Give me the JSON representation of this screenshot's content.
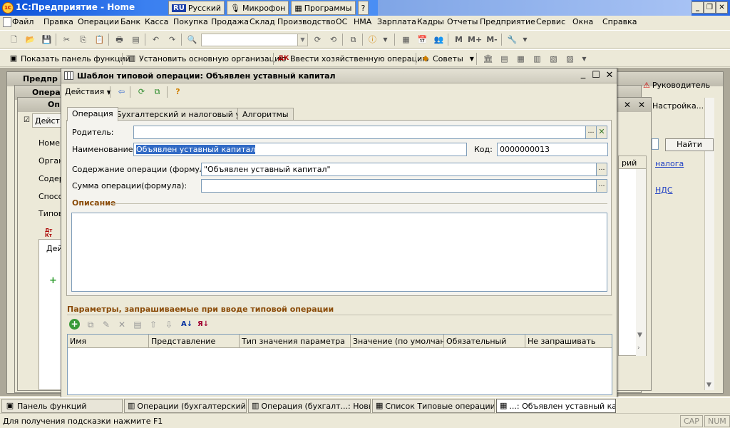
{
  "app": {
    "title": "1С:Предприятие - Home",
    "icon_label": "1C",
    "lang_bar": {
      "lang_code": "RU",
      "lang_name": "Русский",
      "mic": "Микрофон",
      "programs": "Программы",
      "help": "?"
    }
  },
  "menu": {
    "items": [
      "Файл",
      "Правка",
      "Операции",
      "Банк",
      "Касса",
      "Покупка",
      "Продажа",
      "Склад",
      "Производство",
      "ОС",
      "НМА",
      "Зарплата",
      "Кадры",
      "Отчеты",
      "Предприятие",
      "Сервис",
      "Окна",
      "Справка"
    ]
  },
  "toolbar2": {
    "show_panel": "Показать панель функций",
    "set_org": "Установить основную организацию",
    "enter_op": "Ввести хозяйственную операцию",
    "tips": "Советы"
  },
  "background": {
    "win1_title_part": "Предпр",
    "win2_title_part": "Опера",
    "win3_title_part": "Оп",
    "tab_fragment": "Де",
    "actions_fragment": "Дейст",
    "labels": [
      "Номер",
      "Орган",
      "Содер",
      "Спосо",
      "Типов"
    ],
    "dk_fragment": "Дт\nКт",
    "de_fragment": "Дей",
    "role_tr": "тр",
    "role_head": "Руководитель",
    "settings": "Настройка...",
    "find_button": "Найти",
    "col_fragment": "рий",
    "link_tax": "налога",
    "link_vat": "НДС"
  },
  "dialog": {
    "title": "Шаблон типовой операции: Объявлен уставный капитал",
    "actions": "Действия",
    "tabs": [
      "Операция",
      "Бухгалтерский и налоговый учет",
      "Алгоритмы"
    ],
    "active_tab": 0,
    "fields": {
      "parent_label": "Родитель:",
      "parent_value": "",
      "name_label": "Наименование:",
      "name_value": "Объявлен уставный капитал",
      "code_label": "Код:",
      "code_value": "0000000013",
      "content_label": "Содержание операции (формула):",
      "content_value": "\"Объявлен уставный капитал\"",
      "sum_label": "Сумма операции(формула):",
      "sum_value": ""
    },
    "description_title": "Описание",
    "description_value": "",
    "params_title": "Параметры, запрашиваемые при вводе типовой операции",
    "params_columns": [
      "Имя",
      "Представление",
      "Тип значения параметра",
      "Значение (по умолчан...",
      "Обязательный",
      "Не запрашивать"
    ]
  },
  "taskbar": {
    "items": [
      "Панель функций",
      "Операции (бухгалтерский и...",
      "Операция (бухгалт...: Новый *",
      "Список Типовые операции",
      "...: Объявлен уставный кап..."
    ],
    "active_index": 4
  },
  "status": {
    "hint": "Для получения подсказки нажмите F1",
    "cap": "CAP",
    "num": "NUM"
  }
}
